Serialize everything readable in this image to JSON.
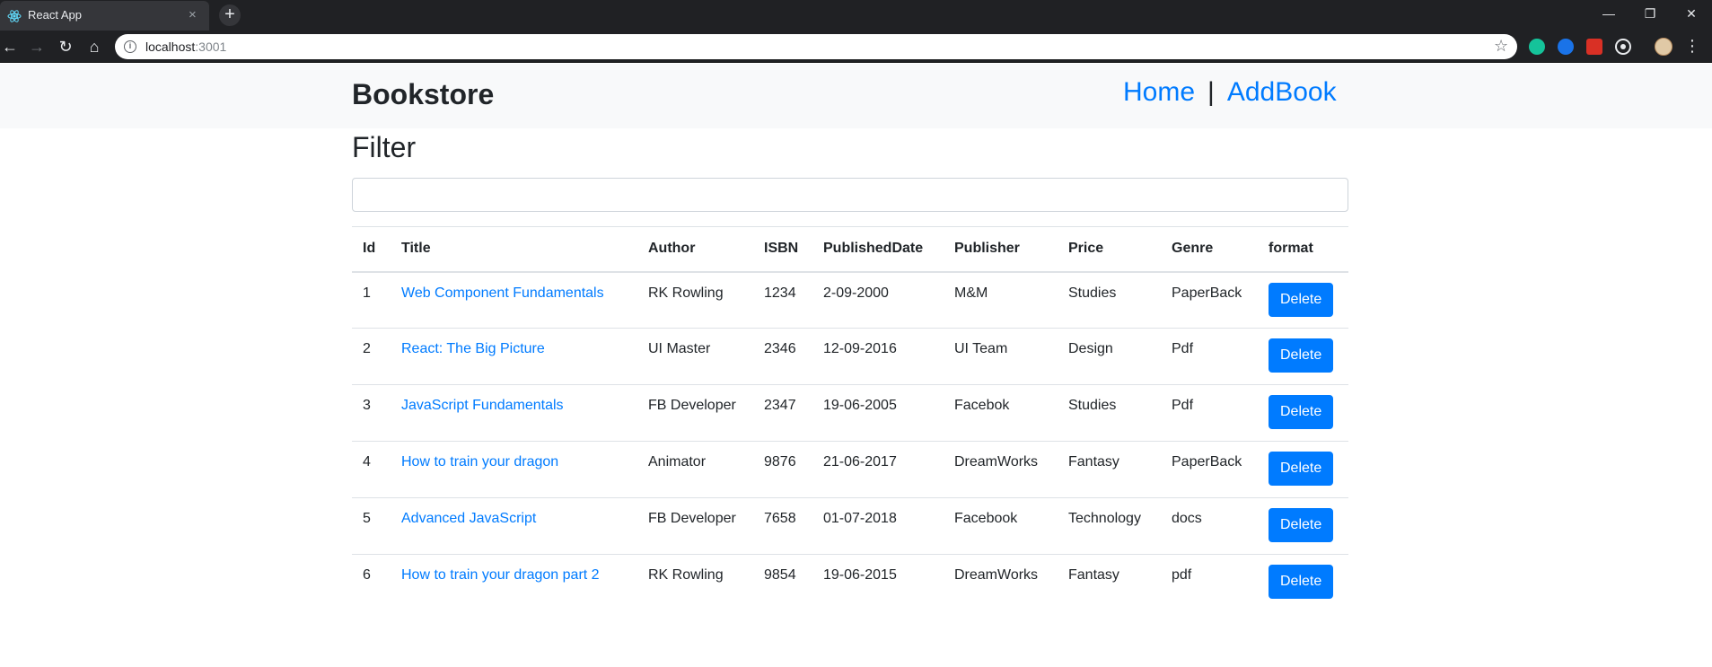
{
  "browser": {
    "tab_title": "React App",
    "tab_close": "×",
    "new_tab": "+",
    "url_host": "localhost",
    "url_port": ":3001",
    "controls": {
      "minimize": "—",
      "restore": "❐",
      "close": "✕"
    }
  },
  "navbar": {
    "brand": "Bookstore",
    "links": [
      "Home",
      "AddBook"
    ],
    "separator": "|"
  },
  "filter": {
    "title": "Filter",
    "value": ""
  },
  "table": {
    "columns": [
      "Id",
      "Title",
      "Author",
      "ISBN",
      "PublishedDate",
      "Publisher",
      "Price",
      "Genre",
      "format"
    ],
    "delete_label": "Delete",
    "rows": [
      {
        "id": "1",
        "title": "Web Component Fundamentals",
        "author": "RK Rowling",
        "isbn": "1234",
        "published": "2-09-2000",
        "publisher": "M&M",
        "price": "Studies",
        "genre": "PaperBack"
      },
      {
        "id": "2",
        "title": "React: The Big Picture",
        "author": "UI Master",
        "isbn": "2346",
        "published": "12-09-2016",
        "publisher": "UI Team",
        "price": "Design",
        "genre": "Pdf"
      },
      {
        "id": "3",
        "title": "JavaScript Fundamentals",
        "author": "FB Developer",
        "isbn": "2347",
        "published": "19-06-2005",
        "publisher": "Facebok",
        "price": "Studies",
        "genre": "Pdf"
      },
      {
        "id": "4",
        "title": "How to train your dragon",
        "author": "Animator",
        "isbn": "9876",
        "published": "21-06-2017",
        "publisher": "DreamWorks",
        "price": "Fantasy",
        "genre": "PaperBack"
      },
      {
        "id": "5",
        "title": "Advanced JavaScript",
        "author": "FB Developer",
        "isbn": "7658",
        "published": "01-07-2018",
        "publisher": "Facebook",
        "price": "Technology",
        "genre": "docs"
      },
      {
        "id": "6",
        "title": "How to train your dragon part 2",
        "author": "RK Rowling",
        "isbn": "9854",
        "published": "19-06-2015",
        "publisher": "DreamWorks",
        "price": "Fantasy",
        "genre": "pdf"
      }
    ]
  },
  "colors": {
    "primary": "#007bff",
    "navbar_bg": "#f8f9fa",
    "chrome_bg": "#202124"
  }
}
